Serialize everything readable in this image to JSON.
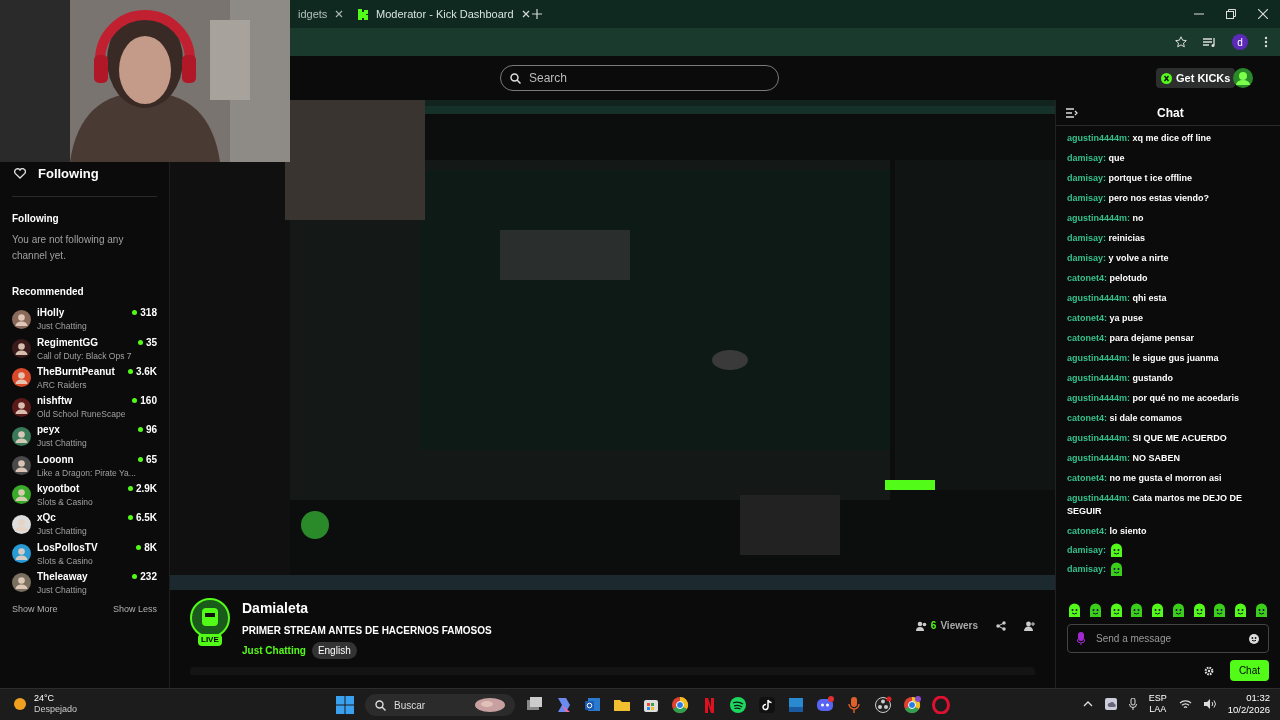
{
  "browser": {
    "profile_initial": "d",
    "tabs": [
      {
        "title": "idgets",
        "selected": false
      },
      {
        "title": "Moderator - Kick Dashboard",
        "selected": true
      }
    ]
  },
  "topbar": {
    "search": {
      "placeholder": "Search"
    },
    "get_kicks": "Get KICKs"
  },
  "sidebar": {
    "header": "Following",
    "following_title": "Following",
    "empty_text": "You are not following any channel yet.",
    "recommended_title": "Recommended",
    "channels": [
      {
        "name": "iHolly",
        "category": "Just Chatting",
        "viewers": "318"
      },
      {
        "name": "RegimentGG",
        "category": "Call of Duty: Black Ops 7",
        "viewers": "35"
      },
      {
        "name": "TheBurntPeanut",
        "category": "ARC Raiders",
        "viewers": "3.6K"
      },
      {
        "name": "nishftw",
        "category": "Old School RuneScape",
        "viewers": "160"
      },
      {
        "name": "peyx",
        "category": "Just Chatting",
        "viewers": "96"
      },
      {
        "name": "Looonn",
        "category": "Like a Dragon: Pirate Ya...",
        "viewers": "65"
      },
      {
        "name": "kyootbot",
        "category": "Slots & Casino",
        "viewers": "2.9K"
      },
      {
        "name": "xQc",
        "category": "Just Chatting",
        "viewers": "6.5K"
      },
      {
        "name": "LosPollosTV",
        "category": "Slots & Casino",
        "viewers": "8K"
      },
      {
        "name": "Theleaway",
        "category": "Just Chatting",
        "viewers": "232"
      }
    ],
    "show_more": "Show More",
    "show_less": "Show Less"
  },
  "stream": {
    "live": "LIVE",
    "channel": "Damialeta",
    "title": "PRIMER STREAM ANTES DE HACERNOS FAMOSOS",
    "category": "Just Chatting",
    "tag": "English",
    "viewer_count": "6",
    "viewers_label": "Viewers"
  },
  "chat": {
    "title": "Chat",
    "messages": [
      {
        "kind": "text",
        "user": "agustin4444m:",
        "text": "xq me dice off line"
      },
      {
        "kind": "text",
        "user": "damisay:",
        "text": "que"
      },
      {
        "kind": "text",
        "user": "damisay:",
        "text": "portque t ice offline"
      },
      {
        "kind": "text",
        "user": "damisay:",
        "text": "pero nos estas viendo?"
      },
      {
        "kind": "text",
        "user": "agustin4444m:",
        "text": "no"
      },
      {
        "kind": "text",
        "user": "damisay:",
        "text": "reinicias"
      },
      {
        "kind": "text",
        "user": "damisay:",
        "text": "y volve a nirte"
      },
      {
        "kind": "text",
        "user": "catonet4:",
        "text": "pelotudo"
      },
      {
        "kind": "text",
        "user": "agustin4444m:",
        "text": "qhi esta"
      },
      {
        "kind": "text",
        "user": "catonet4:",
        "text": "ya puse"
      },
      {
        "kind": "text",
        "user": "catonet4:",
        "text": "para dejame pensar"
      },
      {
        "kind": "text",
        "user": "agustin4444m:",
        "text": "le sigue gus juanma"
      },
      {
        "kind": "text",
        "user": "agustin4444m:",
        "text": "gustando"
      },
      {
        "kind": "text",
        "user": "agustin4444m:",
        "text": "por qué no me acoedaris"
      },
      {
        "kind": "text",
        "user": "catonet4:",
        "text": "si dale comamos"
      },
      {
        "kind": "text",
        "user": "agustin4444m:",
        "text": "SI QUE ME ACUERDO"
      },
      {
        "kind": "text",
        "user": "agustin4444m:",
        "text": "NO SABEN"
      },
      {
        "kind": "text",
        "user": "catonet4:",
        "text": "no me gusta el morron asi"
      },
      {
        "kind": "text",
        "user": "agustin4444m:",
        "text": "Cata martos me DEJO DE SEGUIR"
      },
      {
        "kind": "text",
        "user": "catonet4:",
        "text": "lo siento"
      },
      {
        "kind": "emote",
        "user": "damisay:"
      },
      {
        "kind": "emote",
        "user": "damisay:"
      }
    ],
    "input": {
      "placeholder": "Send a message"
    },
    "send": "Chat"
  },
  "taskbar": {
    "temperature": "24°C",
    "weather": "Despejado",
    "search": "Buscar",
    "lang": "ESP",
    "layout": "LAA",
    "time": "01:32",
    "date": "10/2/2026"
  }
}
